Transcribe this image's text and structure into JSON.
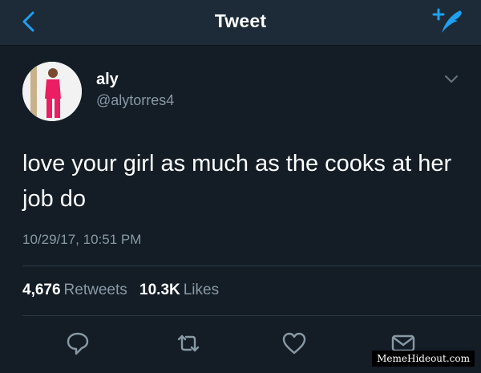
{
  "header": {
    "title": "Tweet",
    "back_icon": "chevron-left-icon",
    "compose_icon": "compose-tweet-icon"
  },
  "tweet": {
    "author_name": "aly",
    "author_handle": "@alytorres4",
    "text": "love your girl as much as the cooks at her job do",
    "timestamp": "10/29/17, 10:51 PM",
    "retweets_count": "4,676",
    "retweets_label": "Retweets",
    "likes_count": "10.3K",
    "likes_label": "Likes"
  },
  "actions": [
    {
      "icon": "reply-icon"
    },
    {
      "icon": "retweet-icon"
    },
    {
      "icon": "heart-icon"
    },
    {
      "icon": "direct-message-icon"
    }
  ],
  "watermark": "MemeHideout.com",
  "colors": {
    "background": "#141d26",
    "header": "#1d2a38",
    "accent": "#1da1f2",
    "secondary_text": "#8899a6"
  }
}
